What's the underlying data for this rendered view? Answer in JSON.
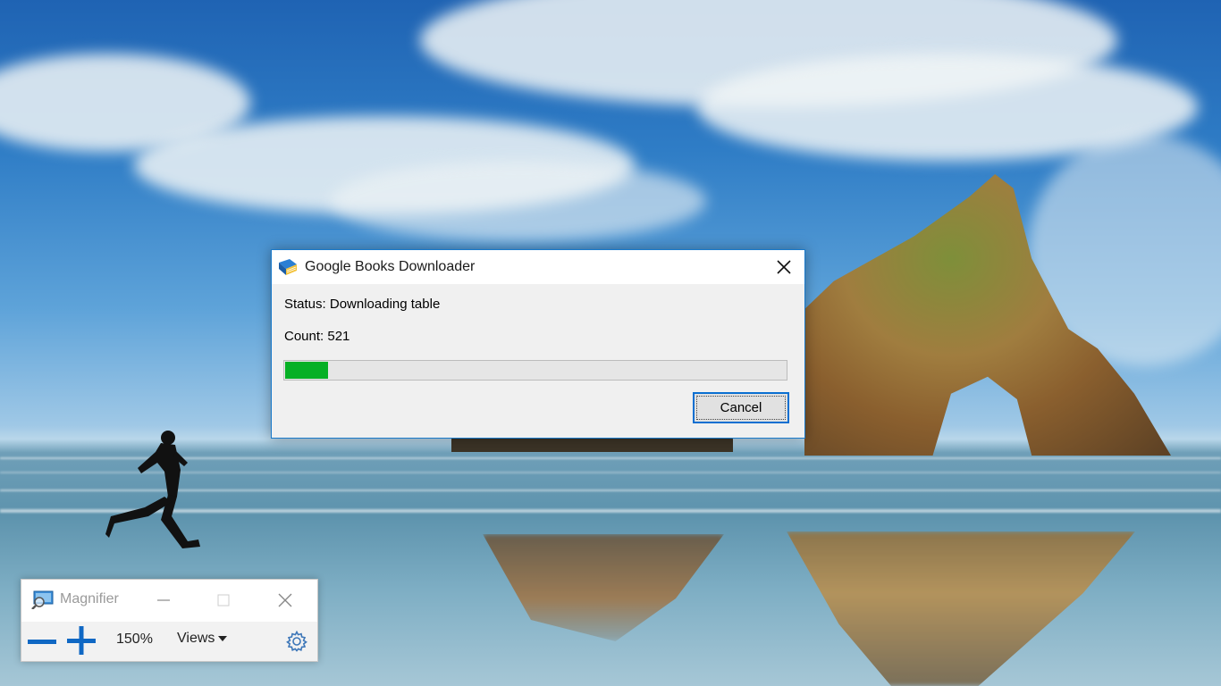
{
  "dialog": {
    "title": "Google Books Downloader",
    "app_icon": "blue-book-icon",
    "close_icon": "close-icon",
    "status_text": "Status: Downloading table",
    "count_text": "Count: 521",
    "progress_fraction": 0.085,
    "progress_color": "#06b025",
    "cancel_label": "Cancel"
  },
  "magnifier": {
    "title": "Magnifier",
    "icon": "magnifier-icon",
    "zoom_level": "150%",
    "views_label": "Views",
    "minimize_icon": "minimize-icon",
    "maximize_icon": "maximize-icon",
    "close_icon": "close-icon",
    "zoom_out_icon": "minus-icon",
    "zoom_in_icon": "plus-icon",
    "settings_icon": "gear-icon",
    "accent": "#1068c4"
  }
}
